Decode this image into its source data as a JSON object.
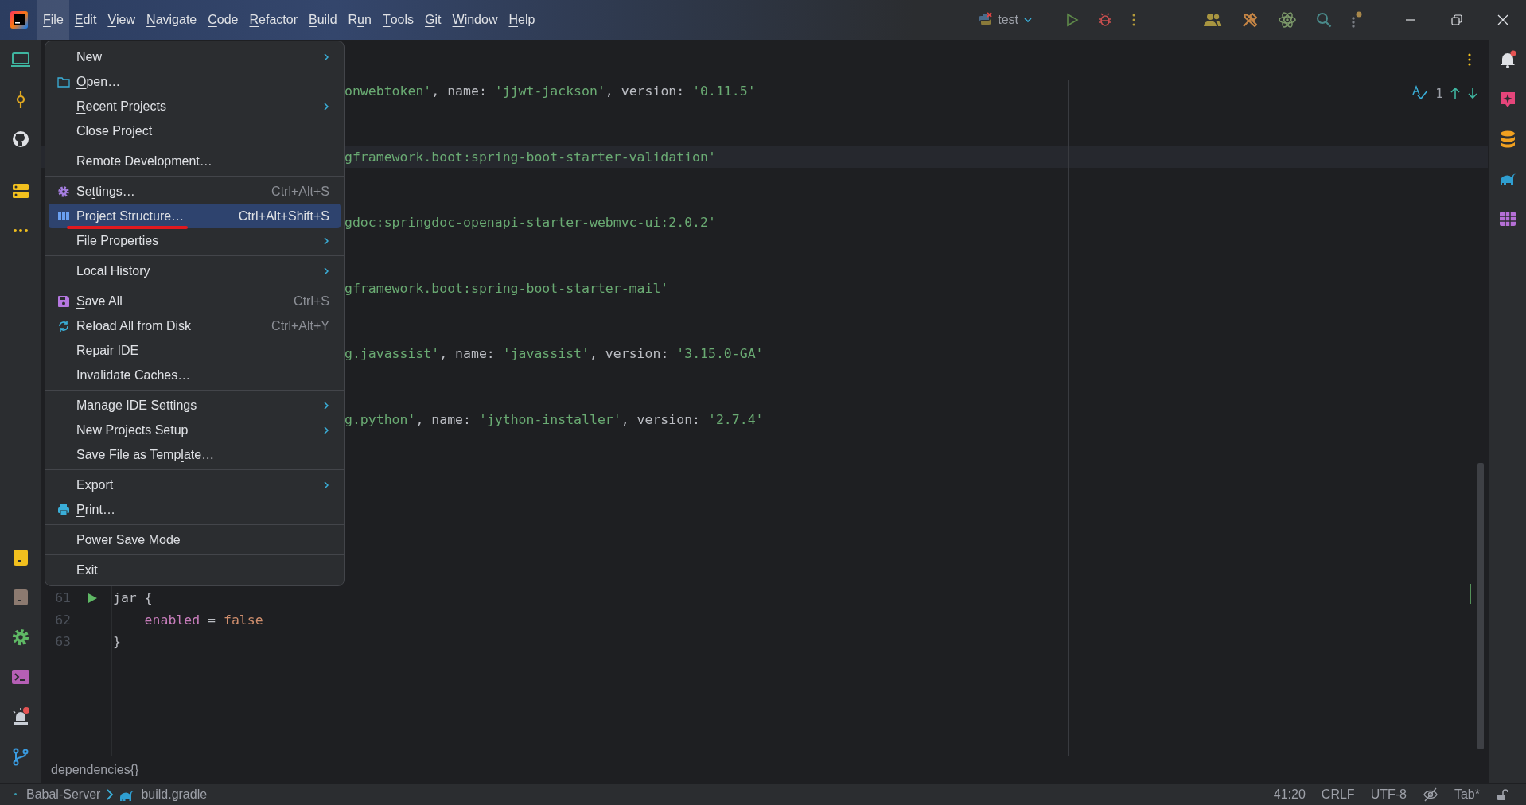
{
  "menu_bar": [
    {
      "key": "F",
      "post": "ile",
      "selected": true
    },
    {
      "key": "E",
      "post": "dit",
      "selected": false
    },
    {
      "key": "V",
      "post": "iew",
      "selected": false
    },
    {
      "key": "N",
      "post": "avigate",
      "selected": false
    },
    {
      "key": "C",
      "post": "ode",
      "selected": false
    },
    {
      "key": "R",
      "post": "efactor",
      "selected": false
    },
    {
      "key": "B",
      "post": "uild",
      "selected": false
    },
    {
      "pre": "R",
      "key": "u",
      "post": "n",
      "selected": false
    },
    {
      "key": "T",
      "post": "ools",
      "selected": false
    },
    {
      "key": "G",
      "post": "it",
      "selected": false
    },
    {
      "key": "W",
      "post": "indow",
      "selected": false
    },
    {
      "key": "H",
      "post": "elp",
      "selected": false
    }
  ],
  "run_config": {
    "name": "test"
  },
  "file_menu": [
    {
      "kind": "item",
      "key": "N",
      "post": "ew",
      "submenu": true,
      "selected": false
    },
    {
      "kind": "item",
      "key": "O",
      "post": "pen…",
      "selected": false
    },
    {
      "kind": "item",
      "key": "R",
      "post": "ecent Projects",
      "submenu": true,
      "selected": false
    },
    {
      "kind": "item",
      "pre": "Close Pro",
      "key": "j",
      "post": "ect",
      "selected": false
    },
    {
      "kind": "separator"
    },
    {
      "kind": "item",
      "pre": "Remote Development…",
      "selected": false
    },
    {
      "kind": "separator"
    },
    {
      "kind": "item",
      "pre": "Se",
      "key": "t",
      "post": "tings…",
      "shortcut": "Ctrl+Alt+S",
      "selected": false
    },
    {
      "kind": "item",
      "pre": "Project Structure…",
      "shortcut": "Ctrl+Alt+Shift+S",
      "selected": true,
      "annotated": true
    },
    {
      "kind": "item",
      "pre": "File Properties",
      "submenu": true,
      "selected": false
    },
    {
      "kind": "separator"
    },
    {
      "kind": "item",
      "pre": "Local ",
      "key": "H",
      "post": "istory",
      "submenu": true,
      "selected": false
    },
    {
      "kind": "separator"
    },
    {
      "kind": "item",
      "key": "S",
      "post": "ave All",
      "shortcut": "Ctrl+S",
      "selected": false
    },
    {
      "kind": "item",
      "pre": "Reload All from Disk",
      "shortcut": "Ctrl+Alt+Y",
      "selected": false
    },
    {
      "kind": "item",
      "pre": "Repair IDE",
      "selected": false
    },
    {
      "kind": "item",
      "pre": "Invalidate Caches…",
      "selected": false
    },
    {
      "kind": "separator"
    },
    {
      "kind": "item",
      "pre": "Manage IDE Settings",
      "submenu": true,
      "selected": false
    },
    {
      "kind": "item",
      "pre": "New Projects Setup",
      "submenu": true,
      "selected": false
    },
    {
      "kind": "item",
      "pre": "Save File as Temp",
      "key": "l",
      "post": "ate…",
      "selected": false
    },
    {
      "kind": "separator"
    },
    {
      "kind": "item",
      "pre": "Export",
      "submenu": true,
      "selected": false
    },
    {
      "kind": "item",
      "key": "P",
      "post": "rint…",
      "selected": false
    },
    {
      "kind": "separator"
    },
    {
      "kind": "item",
      "pre": "Power Save Mode",
      "selected": false
    },
    {
      "kind": "separator"
    },
    {
      "kind": "item",
      "pre": "E",
      "key": "x",
      "post": "it",
      "selected": false
    }
  ],
  "editor": {
    "inspections": {
      "count": "1"
    },
    "lines": [
      {
        "kind": "clipped",
        "current": false,
        "segments": [
          {
            "kind": "string",
            "text": "onwebtoken'"
          },
          {
            "kind": "plain",
            "text": ", name: "
          },
          {
            "kind": "string",
            "text": "'jjwt-jackson'"
          },
          {
            "kind": "plain",
            "text": ", version: "
          },
          {
            "kind": "string",
            "text": "'0.11.5'"
          }
        ]
      },
      {
        "kind": "clipped",
        "current": true,
        "segments": [
          {
            "kind": "string",
            "text": "gframework.boot:spring-boot-starter-validation'"
          }
        ]
      },
      {
        "kind": "clipped",
        "current": false,
        "segments": [
          {
            "kind": "string",
            "text": "gdoc:springdoc-openapi-starter-webmvc-ui:2.0.2'"
          }
        ]
      },
      {
        "kind": "clipped",
        "current": false,
        "segments": [
          {
            "kind": "string",
            "text": "gframework.boot:spring-boot-starter-mail'"
          }
        ]
      },
      {
        "kind": "clipped",
        "current": false,
        "segments": [
          {
            "kind": "string",
            "text": "g.javassist'"
          },
          {
            "kind": "plain",
            "text": ", name: "
          },
          {
            "kind": "string",
            "text": "'javassist'"
          },
          {
            "kind": "plain",
            "text": ", version: "
          },
          {
            "kind": "string",
            "text": "'3.15.0-GA'"
          }
        ]
      },
      {
        "kind": "clipped",
        "current": false,
        "segments": [
          {
            "kind": "string",
            "text": "g.python'"
          },
          {
            "kind": "plain",
            "text": ", name: "
          },
          {
            "kind": "string",
            "text": "'jython-installer'"
          },
          {
            "kind": "plain",
            "text": ", version: "
          },
          {
            "kind": "string",
            "text": "'2.7.4'"
          }
        ]
      },
      {
        "kind": "numbered",
        "number": "61",
        "runnable": true,
        "indented": false,
        "current": false,
        "segments": [
          {
            "kind": "plain",
            "text": "jar {"
          }
        ]
      },
      {
        "kind": "numbered",
        "number": "62",
        "runnable": false,
        "indented": true,
        "current": false,
        "segments": [
          {
            "kind": "property",
            "text": "enabled"
          },
          {
            "kind": "plain",
            "text": " = "
          },
          {
            "kind": "keyword",
            "text": "false"
          }
        ]
      },
      {
        "kind": "numbered",
        "number": "63",
        "runnable": false,
        "indented": false,
        "current": false,
        "segments": [
          {
            "kind": "plain",
            "text": "}"
          }
        ]
      }
    ]
  },
  "breadcrumb": "dependencies{}",
  "status_bar": {
    "path": [
      "Babal-Server",
      "build.gradle"
    ],
    "items": [
      "41:20",
      "CRLF",
      "UTF-8",
      "Tab*"
    ]
  }
}
